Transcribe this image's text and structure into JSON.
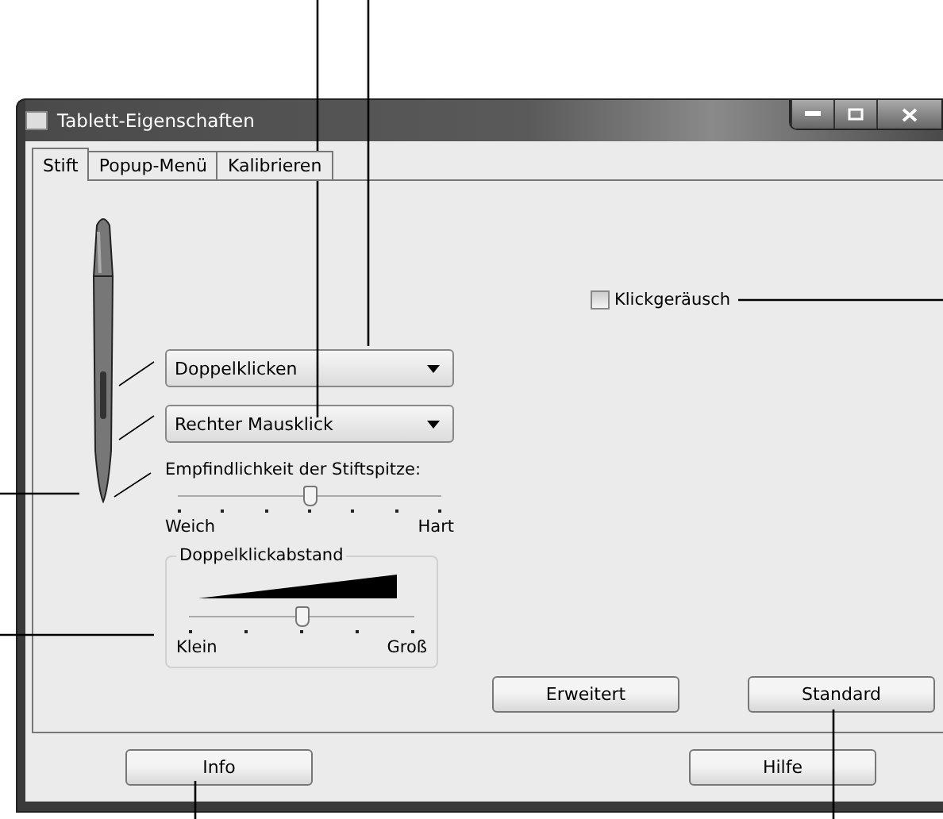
{
  "window": {
    "title": "Tablett-Eigenschaften"
  },
  "tabs": [
    {
      "label": "Stift",
      "selected": true
    },
    {
      "label": "Popup-Menü",
      "selected": false
    },
    {
      "label": "Kalibrieren",
      "selected": false
    }
  ],
  "dropdowns": [
    {
      "value": "Doppelklicken"
    },
    {
      "value": "Rechter Mausklick"
    }
  ],
  "tip_sensitivity": {
    "label": "Empfindlichkeit der Stiftspitze:",
    "level": 0.5,
    "min_label": "Weich",
    "max_label": "Hart"
  },
  "double_click_distance": {
    "title": "Doppelklickabstand",
    "level": 0.5,
    "min_label": "Klein",
    "max_label": "Groß"
  },
  "click_sound": {
    "label": "Klickgeräusch",
    "checked": false
  },
  "tab_buttons": [
    "Erweitert",
    "Standard"
  ],
  "footer_buttons": [
    "Info",
    "Hilfe"
  ]
}
